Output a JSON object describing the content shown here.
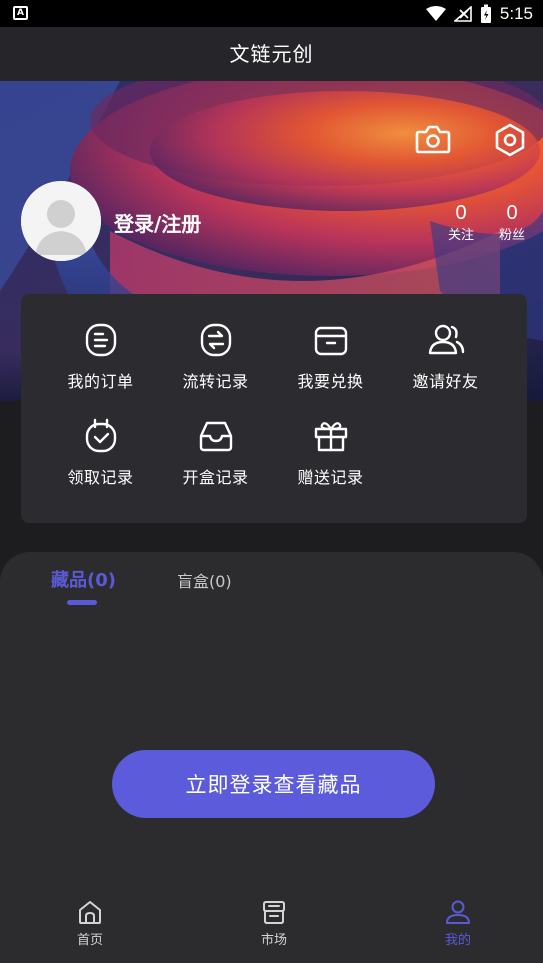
{
  "status_bar": {
    "app_badge": "A",
    "time": "5:15"
  },
  "header": {
    "title": "文链元创"
  },
  "profile": {
    "login_label": "登录/注册",
    "stats": [
      {
        "value": "0",
        "label": "关注"
      },
      {
        "value": "0",
        "label": "粉丝"
      }
    ]
  },
  "menu": {
    "items": [
      {
        "label": "我的订单",
        "icon": "order-icon"
      },
      {
        "label": "流转记录",
        "icon": "transfer-icon"
      },
      {
        "label": "我要兑换",
        "icon": "redeem-icon"
      },
      {
        "label": "邀请好友",
        "icon": "invite-friends-icon"
      },
      {
        "label": "领取记录",
        "icon": "claim-record-icon"
      },
      {
        "label": "开盒记录",
        "icon": "open-box-icon"
      },
      {
        "label": "赠送记录",
        "icon": "gift-record-icon"
      }
    ]
  },
  "collection": {
    "tabs": [
      {
        "label": "藏品(0)",
        "active": true
      },
      {
        "label": "盲盒(0)",
        "active": false
      }
    ],
    "login_button": "立即登录查看藏品"
  },
  "bottom_nav": {
    "items": [
      {
        "label": "首页",
        "icon": "home-icon",
        "active": false
      },
      {
        "label": "市场",
        "icon": "market-icon",
        "active": false
      },
      {
        "label": "我的",
        "icon": "profile-icon",
        "active": true
      }
    ]
  },
  "colors": {
    "accent": "#5b5bdb",
    "background": "#1d1d20",
    "card": "#2c2c30"
  }
}
